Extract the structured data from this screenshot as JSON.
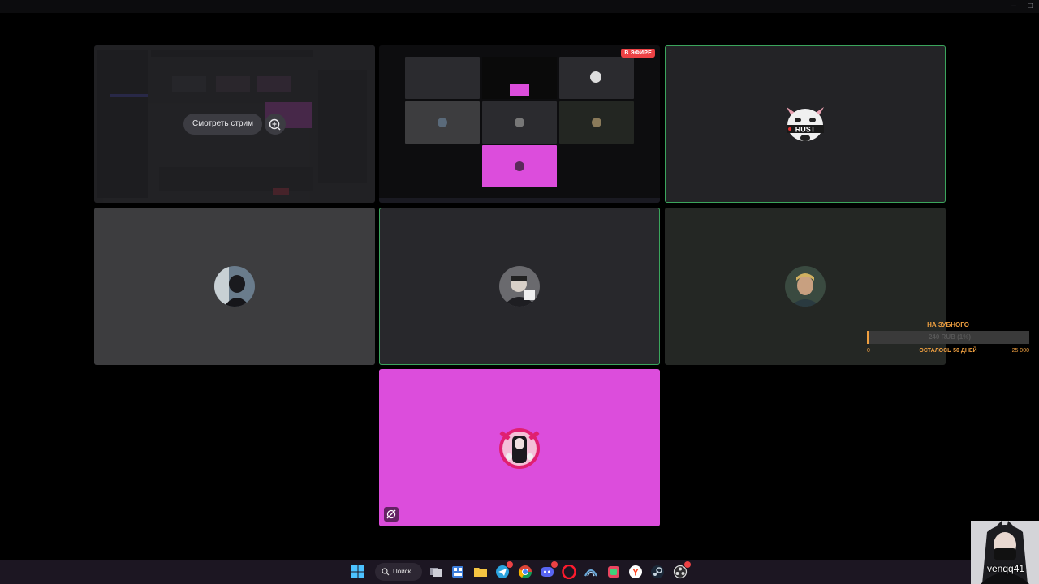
{
  "window": {
    "minimize_glyph": "–",
    "maximize_glyph": "□"
  },
  "call": {
    "tiles": [
      {
        "id": "stream-preview",
        "watch_label": "Смотреть стрим",
        "watch_icon": "join-stream-icon"
      },
      {
        "id": "live-stream",
        "live_badge": "В ЭФИРЕ"
      },
      {
        "id": "rust-user",
        "speaking": true,
        "avatar": "rust-pig-avatar"
      },
      {
        "id": "user-4",
        "avatar": "user-avatar"
      },
      {
        "id": "user-5",
        "speaking": true,
        "avatar": "user-avatar"
      },
      {
        "id": "user-6",
        "avatar": "user-avatar"
      },
      {
        "id": "user-7",
        "avatar": "anime-avatar",
        "status_icon": "muted-mic-icon"
      }
    ]
  },
  "donation_goal": {
    "title": "НА ЗУБНОГО",
    "amount": "240 RUB (1%)",
    "min": "0",
    "remaining": "ОСТАЛОСЬ 50 ДНЕЙ",
    "max": "25 000",
    "progress_fraction": 0.01,
    "accent": "#f0a040"
  },
  "webcam": {
    "label": "venqq41"
  },
  "taskbar": {
    "search_label": "Поиск",
    "apps": [
      "windows-start-icon",
      "search-icon",
      "task-view-icon",
      "widgets-icon",
      "file-explorer-icon",
      "telegram-icon",
      "chrome-icon",
      "discord-icon",
      "opera-icon",
      "wireshark-icon",
      "wechat-icon",
      "yandex-icon",
      "steam-icon",
      "obs-icon"
    ]
  },
  "colors": {
    "speaking_outline": "#3ba55c",
    "live_badge": "#ed4245",
    "pink_tile": "#dc4ddc"
  }
}
